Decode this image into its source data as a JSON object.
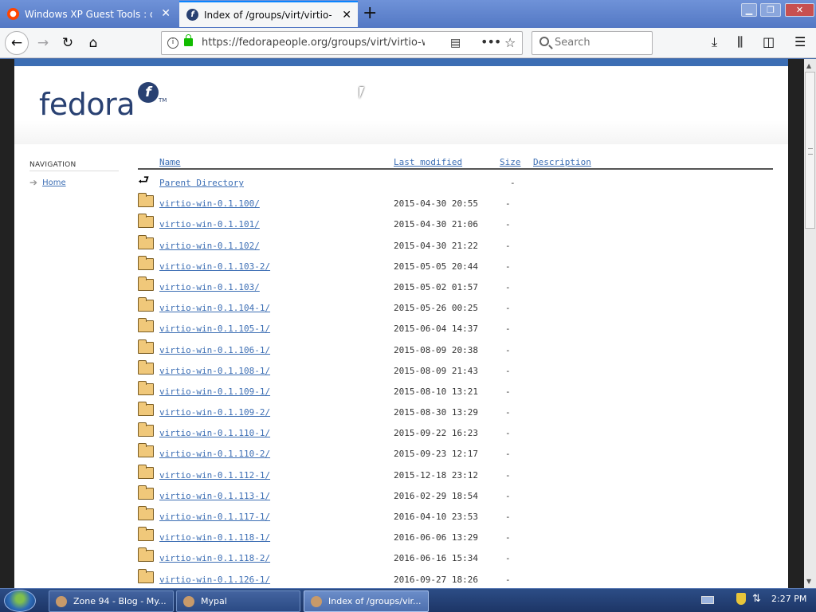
{
  "browser": {
    "tabs": [
      {
        "title": "Windows XP Guest Tools : qem",
        "favicon": "reddit-icon",
        "active": false
      },
      {
        "title": "Index of /groups/virt/virtio-win/",
        "favicon": "fedora-icon",
        "active": true
      }
    ],
    "url": "https://fedorapeople.org/groups/virt/virtio-win",
    "search_placeholder": "Search"
  },
  "page": {
    "logo_text": "fedora",
    "logo_mark": "f",
    "logo_tm": "TM",
    "navigation": {
      "heading": "NAVIGATION",
      "items": [
        {
          "label": "Home"
        }
      ]
    },
    "listing": {
      "columns": {
        "name": "Name",
        "last_modified": "Last modified",
        "size": "Size",
        "description": "Description"
      },
      "parent": {
        "name": "Parent Directory",
        "size": "-"
      },
      "rows": [
        {
          "name": "virtio-win-0.1.100/",
          "modified": "2015-04-30 20:55",
          "size": "-"
        },
        {
          "name": "virtio-win-0.1.101/",
          "modified": "2015-04-30 21:06",
          "size": "-"
        },
        {
          "name": "virtio-win-0.1.102/",
          "modified": "2015-04-30 21:22",
          "size": "-"
        },
        {
          "name": "virtio-win-0.1.103-2/",
          "modified": "2015-05-05 20:44",
          "size": "-"
        },
        {
          "name": "virtio-win-0.1.103/",
          "modified": "2015-05-02 01:57",
          "size": "-"
        },
        {
          "name": "virtio-win-0.1.104-1/",
          "modified": "2015-05-26 00:25",
          "size": "-"
        },
        {
          "name": "virtio-win-0.1.105-1/",
          "modified": "2015-06-04 14:37",
          "size": "-"
        },
        {
          "name": "virtio-win-0.1.106-1/",
          "modified": "2015-08-09 20:38",
          "size": "-"
        },
        {
          "name": "virtio-win-0.1.108-1/",
          "modified": "2015-08-09 21:43",
          "size": "-"
        },
        {
          "name": "virtio-win-0.1.109-1/",
          "modified": "2015-08-10 13:21",
          "size": "-"
        },
        {
          "name": "virtio-win-0.1.109-2/",
          "modified": "2015-08-30 13:29",
          "size": "-"
        },
        {
          "name": "virtio-win-0.1.110-1/",
          "modified": "2015-09-22 16:23",
          "size": "-"
        },
        {
          "name": "virtio-win-0.1.110-2/",
          "modified": "2015-09-23 12:17",
          "size": "-"
        },
        {
          "name": "virtio-win-0.1.112-1/",
          "modified": "2015-12-18 23:12",
          "size": "-"
        },
        {
          "name": "virtio-win-0.1.113-1/",
          "modified": "2016-02-29 18:54",
          "size": "-"
        },
        {
          "name": "virtio-win-0.1.117-1/",
          "modified": "2016-04-10 23:53",
          "size": "-"
        },
        {
          "name": "virtio-win-0.1.118-1/",
          "modified": "2016-06-06 13:29",
          "size": "-"
        },
        {
          "name": "virtio-win-0.1.118-2/",
          "modified": "2016-06-16 15:34",
          "size": "-"
        },
        {
          "name": "virtio-win-0.1.126-1/",
          "modified": "2016-09-27 18:26",
          "size": "-"
        }
      ]
    }
  },
  "taskbar": {
    "items": [
      {
        "label": "Zone 94 - Blog - My..."
      },
      {
        "label": "Mypal"
      },
      {
        "label": "Index of /groups/vir..."
      }
    ],
    "clock": "2:27 PM"
  },
  "colors": {
    "accent": "#3c6eb4",
    "fedora_blue": "#294172",
    "link": "#3c6eb4"
  }
}
